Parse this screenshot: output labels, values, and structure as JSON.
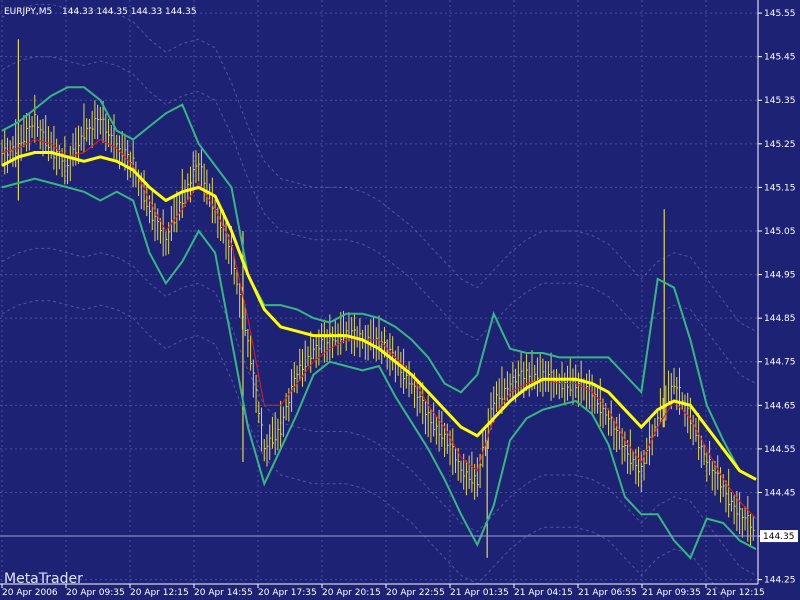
{
  "header": {
    "symbol": "EURJPY,M5",
    "ohlc": "144.33 144.35 144.33 144.35"
  },
  "watermark": "MetaTrader",
  "price_label": "144.35",
  "colors": {
    "background": "#1e2275",
    "grid": "#4a4f9a",
    "candle": "#e2d94a",
    "bollinger": "#34b882",
    "fast_ma": "#e81c1c",
    "slow_ma": "#ffff00",
    "envelope": "#5a62b0",
    "axis_text": "#ffffff",
    "price_label_bg": "#ffffff",
    "price_label_text": "#000000"
  },
  "chart_data": {
    "type": "line",
    "title": "EURJPY,M5",
    "x": [
      "20 Apr 2006",
      "20 Apr 09:35",
      "20 Apr 12:15",
      "20 Apr 14:55",
      "20 Apr 17:35",
      "20 Apr 20:15",
      "20 Apr 22:55",
      "21 Apr 01:35",
      "21 Apr 04:15",
      "21 Apr 06:55",
      "21 Apr 09:35",
      "21 Apr 12:15"
    ],
    "y_ticks": [
      145.55,
      145.45,
      145.35,
      145.25,
      145.15,
      145.05,
      144.95,
      144.85,
      144.75,
      144.65,
      144.55,
      144.45,
      144.35,
      144.25
    ],
    "ylim": [
      144.24,
      145.58
    ],
    "grid": true,
    "last_price": 144.35,
    "series": [
      {
        "name": "",
        "kind": "price",
        "values": [
          145.22,
          145.25,
          145.3,
          145.24,
          145.2,
          145.28,
          145.3,
          145.25,
          145.2,
          145.1,
          145.03,
          145.13,
          145.2,
          145.1,
          145.0,
          144.8,
          144.55,
          144.6,
          144.72,
          144.78,
          144.8,
          144.82,
          144.8,
          144.8,
          144.75,
          144.7,
          144.62,
          144.58,
          144.5,
          144.48,
          144.66,
          144.7,
          144.72,
          144.72,
          144.7,
          144.7,
          144.68,
          144.62,
          144.55,
          144.5,
          144.62,
          144.7,
          144.62,
          144.52,
          144.46,
          144.4,
          144.36
        ]
      },
      {
        "name": "",
        "kind": "slow_ma",
        "values": [
          145.2,
          145.22,
          145.23,
          145.23,
          145.22,
          145.21,
          145.22,
          145.21,
          145.19,
          145.15,
          145.12,
          145.14,
          145.15,
          145.13,
          145.05,
          144.95,
          144.87,
          144.83,
          144.82,
          144.81,
          144.81,
          144.81,
          144.8,
          144.78,
          144.75,
          144.72,
          144.68,
          144.64,
          144.6,
          144.58,
          144.62,
          144.66,
          144.69,
          144.71,
          144.71,
          144.71,
          144.7,
          144.68,
          144.64,
          144.6,
          144.64,
          144.66,
          144.65,
          144.6,
          144.55,
          144.5,
          144.48
        ]
      },
      {
        "name": "",
        "kind": "fast_ma",
        "values": [
          145.23,
          145.24,
          145.26,
          145.25,
          145.22,
          145.23,
          145.26,
          145.24,
          145.2,
          145.12,
          145.05,
          145.1,
          145.16,
          145.1,
          145.02,
          144.85,
          144.65,
          144.65,
          144.7,
          144.75,
          144.78,
          144.8,
          144.8,
          144.8,
          144.76,
          144.72,
          144.65,
          144.6,
          144.53,
          144.5,
          144.62,
          144.68,
          144.7,
          144.71,
          144.7,
          144.7,
          144.68,
          144.64,
          144.57,
          144.52,
          144.6,
          144.66,
          144.62,
          144.55,
          144.48,
          144.43,
          144.39
        ]
      },
      {
        "name": "",
        "kind": "bollinger_upper",
        "values": [
          145.28,
          145.3,
          145.33,
          145.36,
          145.38,
          145.38,
          145.35,
          145.28,
          145.26,
          145.29,
          145.32,
          145.34,
          145.25,
          145.2,
          145.15,
          144.95,
          144.88,
          144.88,
          144.87,
          144.85,
          144.84,
          144.86,
          144.86,
          144.85,
          144.83,
          144.8,
          144.76,
          144.7,
          144.68,
          144.72,
          144.86,
          144.78,
          144.77,
          144.77,
          144.76,
          144.76,
          144.76,
          144.76,
          144.72,
          144.68,
          144.94,
          144.92,
          144.8,
          144.65,
          144.57,
          144.5,
          144.48
        ]
      },
      {
        "name": "",
        "kind": "bollinger_lower",
        "values": [
          145.15,
          145.16,
          145.17,
          145.16,
          145.15,
          145.14,
          145.12,
          145.14,
          145.12,
          145.0,
          144.93,
          144.98,
          145.05,
          145.0,
          144.8,
          144.6,
          144.47,
          144.55,
          144.63,
          144.72,
          144.75,
          144.74,
          144.73,
          144.74,
          144.67,
          144.61,
          144.55,
          144.48,
          144.4,
          144.33,
          144.42,
          144.57,
          144.62,
          144.64,
          144.65,
          144.66,
          144.63,
          144.56,
          144.44,
          144.4,
          144.4,
          144.34,
          144.3,
          144.39,
          144.38,
          144.34,
          144.32
        ]
      }
    ]
  }
}
